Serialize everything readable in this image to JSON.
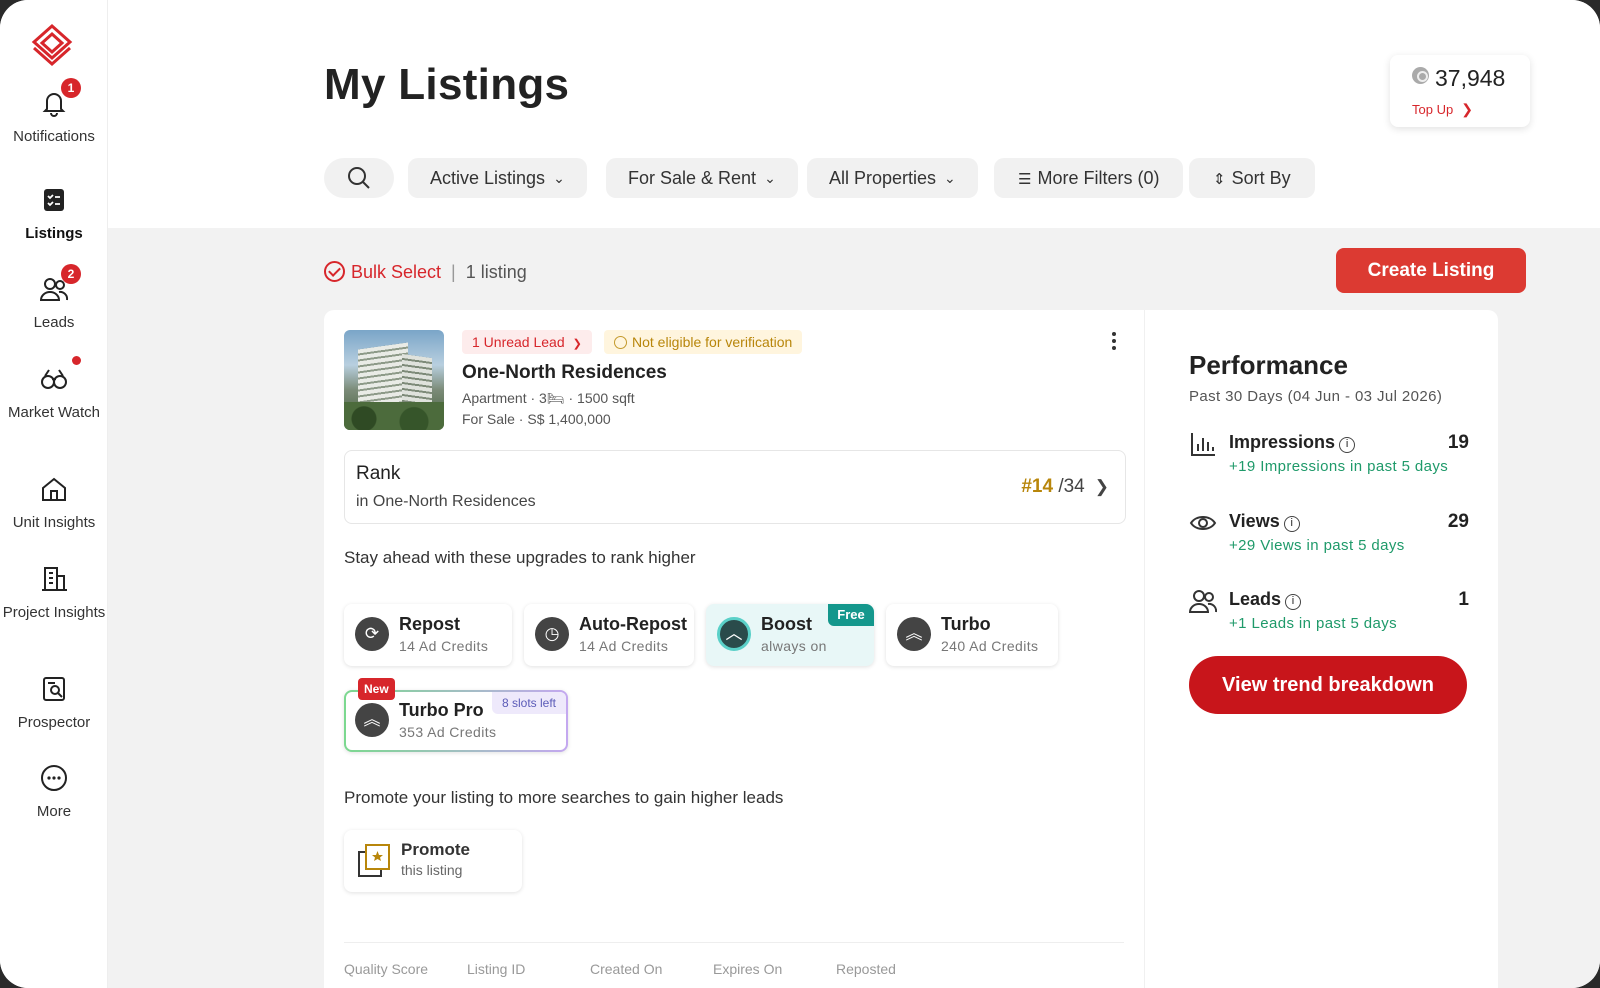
{
  "sidebar": {
    "items": [
      {
        "label": "Notifications",
        "icon": "bell-icon",
        "badge": "1"
      },
      {
        "label": "Listings",
        "icon": "listings-icon",
        "active": true
      },
      {
        "label": "Leads",
        "icon": "people-icon",
        "badge": "2"
      },
      {
        "label": "Market Watch",
        "icon": "binoculars-icon",
        "dot": true
      },
      {
        "label": "Unit Insights",
        "icon": "house-icon"
      },
      {
        "label": "Project Insights",
        "icon": "building-icon"
      },
      {
        "label": "Prospector",
        "icon": "prospector-icon"
      },
      {
        "label": "More",
        "icon": "more-icon"
      }
    ]
  },
  "header": {
    "title": "My Listings",
    "credits": {
      "value": "37,948",
      "topup_label": "Top Up"
    },
    "filters": {
      "active_listings": "Active Listings",
      "sale_rent": "For Sale & Rent",
      "all_properties": "All Properties",
      "more_filters": "More Filters (0)",
      "sort_by": "Sort By"
    }
  },
  "toolbar": {
    "bulk_select": "Bulk Select",
    "count": "1 listing",
    "create_listing": "Create Listing"
  },
  "listing": {
    "tags": {
      "unread": "1 Unread Lead",
      "verification": "Not eligible for verification"
    },
    "name": "One-North Residences",
    "meta_line1": "Apartment · 3🛏 · 1500 sqft",
    "meta_line2": "For Sale · S$ 1,400,000",
    "rank": {
      "title": "Rank",
      "subtitle": "in One-North Residences",
      "position": "#14",
      "total": "/34"
    },
    "upgrades_heading": "Stay ahead with these upgrades to rank higher",
    "upgrades": {
      "repost": {
        "title": "Repost",
        "sub": "14 Ad Credits"
      },
      "autorepost": {
        "title": "Auto-Repost",
        "sub": "14 Ad Credits"
      },
      "boost": {
        "title": "Boost",
        "sub": "always on",
        "tag": "Free"
      },
      "turbo": {
        "title": "Turbo",
        "sub": "240 Ad Credits"
      },
      "turbopro": {
        "title": "Turbo Pro",
        "sub": "353 Ad Credits",
        "new_tag": "New",
        "slots_tag": "8 slots left"
      }
    },
    "promote_heading": "Promote your listing to more searches to gain higher leads",
    "promote": {
      "title": "Promote",
      "sub": "this listing"
    },
    "footer_cols": [
      "Quality Score",
      "Listing ID",
      "Created On",
      "Expires On",
      "Reposted"
    ]
  },
  "performance": {
    "title": "Performance",
    "period": "Past 30 Days (04 Jun - 03 Jul 2026)",
    "metrics": [
      {
        "name": "Impressions",
        "value": "19",
        "delta": "+19 Impressions in past 5 days"
      },
      {
        "name": "Views",
        "value": "29",
        "delta": "+29 Views in past 5 days"
      },
      {
        "name": "Leads",
        "value": "1",
        "delta": "+1 Leads in past 5 days"
      }
    ],
    "trend_button": "View trend breakdown"
  },
  "colors": {
    "brand_red": "#d7262b",
    "accent_green": "#1f9a6a",
    "rank_gold": "#b8860b",
    "boost_teal": "#14978c"
  }
}
